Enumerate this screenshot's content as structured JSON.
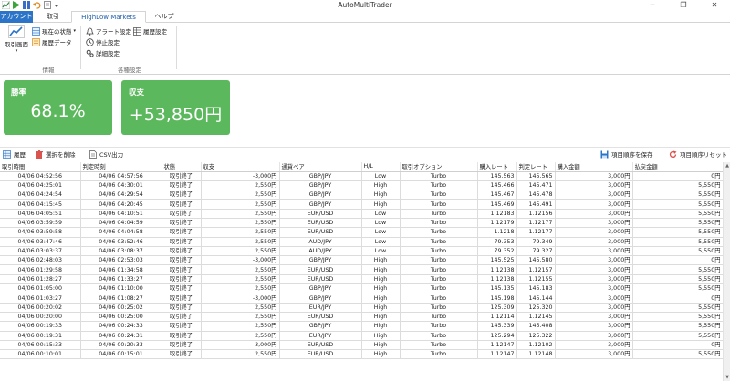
{
  "window": {
    "title": "AutoMultiTrader",
    "minimize": "─",
    "restore": "❐",
    "close": "✕"
  },
  "tabs": [
    {
      "label": "アカウント"
    },
    {
      "label": "取引"
    },
    {
      "label": "HighLow Markets"
    },
    {
      "label": "ヘルプ"
    }
  ],
  "ribbon": {
    "trade_screen": "取引画面",
    "current_status": "現在の状態",
    "history_data": "履歴データ",
    "group_info": "情報",
    "alert_settings": "アラート設定",
    "stop_settings": "停止設定",
    "detail_settings": "詳細設定",
    "history_settings": "履歴設定",
    "group_settings": "各種設定"
  },
  "cards": {
    "win_rate_label": "勝率",
    "win_rate_value": "68.1%",
    "balance_label": "収支",
    "balance_value": "+53,850円"
  },
  "toolbar": {
    "history": "履歴",
    "delete_selected": "選択を削除",
    "csv_export": "CSV出力",
    "save_column_order": "項目順序を保存",
    "reset_column_order": "項目順序リセット"
  },
  "colors": {
    "accent": "#2b74c7",
    "card_green": "#5cb85c",
    "delete_red": "#d9534f"
  },
  "table": {
    "headers": [
      "取引時間",
      "判定時刻",
      "状態",
      "収支",
      "通貨ペア",
      "H/L",
      "取引オプション",
      "購入レート",
      "判定レート",
      "購入金額",
      "払戻金額"
    ],
    "rows": [
      [
        "04/06 04:52:56",
        "04/06 04:57:56",
        "取引終了",
        "-3,000円",
        "GBP/JPY",
        "Low",
        "Turbo",
        "145.563",
        "145.565",
        "3,000円",
        "0円"
      ],
      [
        "04/06 04:25:01",
        "04/06 04:30:01",
        "取引終了",
        "2,550円",
        "GBP/JPY",
        "High",
        "Turbo",
        "145.466",
        "145.471",
        "3,000円",
        "5,550円"
      ],
      [
        "04/06 04:24:54",
        "04/06 04:29:54",
        "取引終了",
        "2,550円",
        "GBP/JPY",
        "High",
        "Turbo",
        "145.467",
        "145.478",
        "3,000円",
        "5,550円"
      ],
      [
        "04/06 04:15:45",
        "04/06 04:20:45",
        "取引終了",
        "2,550円",
        "GBP/JPY",
        "High",
        "Turbo",
        "145.469",
        "145.491",
        "3,000円",
        "5,550円"
      ],
      [
        "04/06 04:05:51",
        "04/06 04:10:51",
        "取引終了",
        "2,550円",
        "EUR/USD",
        "Low",
        "Turbo",
        "1.12183",
        "1.12156",
        "3,000円",
        "5,550円"
      ],
      [
        "04/06 03:59:59",
        "04/06 04:04:59",
        "取引終了",
        "2,550円",
        "EUR/USD",
        "Low",
        "Turbo",
        "1.12179",
        "1.12177",
        "3,000円",
        "5,550円"
      ],
      [
        "04/06 03:59:58",
        "04/06 04:04:58",
        "取引終了",
        "2,550円",
        "EUR/USD",
        "Low",
        "Turbo",
        "1.1218",
        "1.12177",
        "3,000円",
        "5,550円"
      ],
      [
        "04/06 03:47:46",
        "04/06 03:52:46",
        "取引終了",
        "2,550円",
        "AUD/JPY",
        "Low",
        "Turbo",
        "79.353",
        "79.349",
        "3,000円",
        "5,550円"
      ],
      [
        "04/06 03:03:37",
        "04/06 03:08:37",
        "取引終了",
        "2,550円",
        "AUD/JPY",
        "Low",
        "Turbo",
        "79.352",
        "79.327",
        "3,000円",
        "5,550円"
      ],
      [
        "04/06 02:48:03",
        "04/06 02:53:03",
        "取引終了",
        "-3,000円",
        "GBP/JPY",
        "High",
        "Turbo",
        "145.525",
        "145.580",
        "3,000円",
        "0円"
      ],
      [
        "04/06 01:29:58",
        "04/06 01:34:58",
        "取引終了",
        "2,550円",
        "EUR/USD",
        "High",
        "Turbo",
        "1.12138",
        "1.12157",
        "3,000円",
        "5,550円"
      ],
      [
        "04/06 01:28:27",
        "04/06 01:33:27",
        "取引終了",
        "2,550円",
        "EUR/USD",
        "High",
        "Turbo",
        "1.12138",
        "1.12155",
        "3,000円",
        "5,550円"
      ],
      [
        "04/06 01:05:00",
        "04/06 01:10:00",
        "取引終了",
        "2,550円",
        "GBP/JPY",
        "High",
        "Turbo",
        "145.135",
        "145.183",
        "3,000円",
        "5,550円"
      ],
      [
        "04/06 01:03:27",
        "04/06 01:08:27",
        "取引終了",
        "-3,000円",
        "GBP/JPY",
        "High",
        "Turbo",
        "145.198",
        "145.144",
        "3,000円",
        "0円"
      ],
      [
        "04/06 00:20:02",
        "04/06 00:25:02",
        "取引終了",
        "2,550円",
        "EUR/JPY",
        "High",
        "Turbo",
        "125.309",
        "125.320",
        "3,000円",
        "5,550円"
      ],
      [
        "04/06 00:20:00",
        "04/06 00:25:00",
        "取引終了",
        "2,550円",
        "EUR/USD",
        "High",
        "Turbo",
        "1.12114",
        "1.12145",
        "3,000円",
        "5,550円"
      ],
      [
        "04/06 00:19:33",
        "04/06 00:24:33",
        "取引終了",
        "2,550円",
        "GBP/JPY",
        "High",
        "Turbo",
        "145.339",
        "145.408",
        "3,000円",
        "5,550円"
      ],
      [
        "04/06 00:19:31",
        "04/06 00:24:31",
        "取引終了",
        "2,550円",
        "EUR/JPY",
        "High",
        "Turbo",
        "125.294",
        "125.322",
        "3,000円",
        "5,550円"
      ],
      [
        "04/06 00:15:33",
        "04/06 00:20:33",
        "取引終了",
        "-3,000円",
        "EUR/USD",
        "High",
        "Turbo",
        "1.12147",
        "1.12102",
        "3,000円",
        "0円"
      ],
      [
        "04/06 00:10:01",
        "04/06 00:15:01",
        "取引終了",
        "2,550円",
        "EUR/USD",
        "High",
        "Turbo",
        "1.12147",
        "1.12148",
        "3,000円",
        "5,550円"
      ]
    ]
  }
}
